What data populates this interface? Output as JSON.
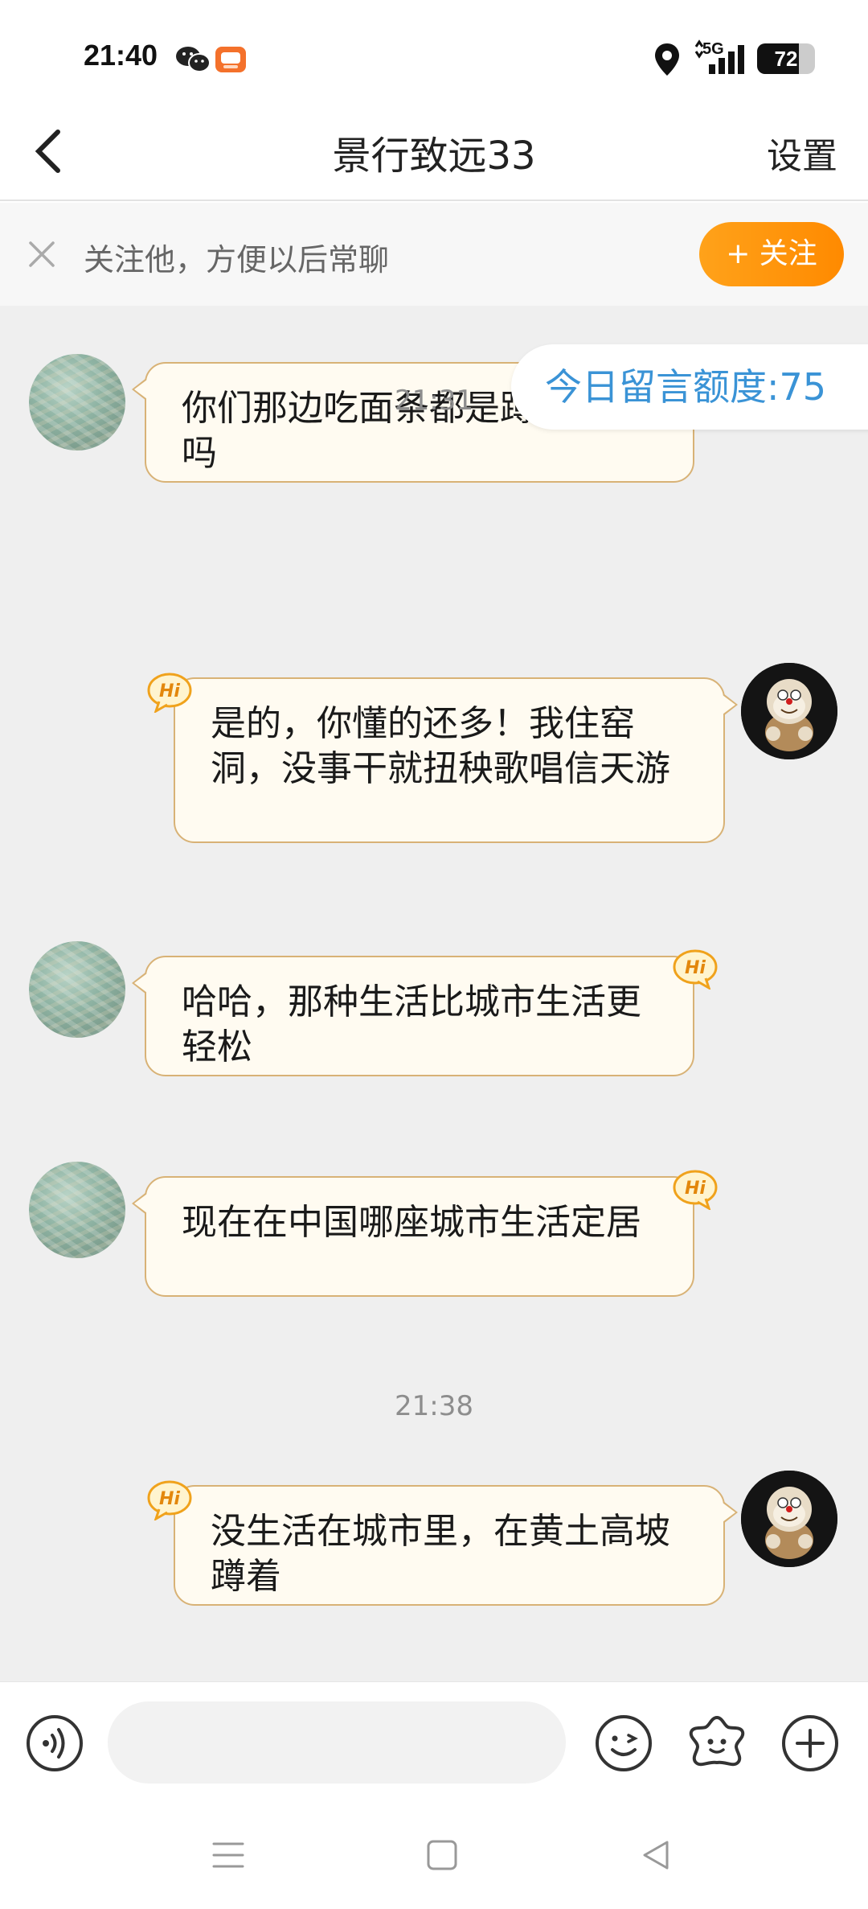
{
  "status_bar": {
    "time": "21:40",
    "network": "5G",
    "battery": "72",
    "battery_level": 0.72,
    "icons": [
      "wechat-icon",
      "app-notification-icon",
      "location-icon",
      "signal-icon",
      "battery-icon"
    ]
  },
  "header": {
    "back_icon": "chevron-left-icon",
    "title": "景行致远33",
    "settings_label": "设置"
  },
  "follow_bar": {
    "text": "关注他，方便以后常聊",
    "button_label": "+ 关注",
    "close_icon": "close-icon"
  },
  "quota": {
    "text": "今日留言额度:75"
  },
  "messages": [
    {
      "side": "left",
      "text": "你们那边吃面条都是蹲着吃是吗",
      "hi_badge": false
    },
    {
      "side": "time",
      "text": "21:31"
    },
    {
      "side": "right",
      "text": "是的，你懂的还多！我住窑洞，没事干就扭秧歌唱信天游",
      "hi_badge": true
    },
    {
      "side": "left",
      "text": "哈哈，那种生活比城市生活更轻松",
      "hi_badge": true
    },
    {
      "side": "left",
      "text": "现在在中国哪座城市生活定居",
      "hi_badge": true
    },
    {
      "side": "time",
      "text": "21:38"
    },
    {
      "side": "right",
      "text": "没生活在城市里，在黄土高坡蹲着",
      "hi_badge": true
    }
  ],
  "hi_label": "Hi",
  "input_bar": {
    "placeholder": "",
    "icons": [
      "voice-icon",
      "emoji-icon",
      "sticker-icon",
      "plus-icon"
    ]
  },
  "nav_bar": {
    "icons": [
      "menu-icon",
      "home-icon",
      "back-triangle-icon"
    ]
  },
  "colors": {
    "accent": "#ff9a0d",
    "bubble_bg": "#fffbf1",
    "bubble_border": "#d8b276",
    "quota_text": "#3a93d6",
    "chat_bg": "#efefef"
  }
}
